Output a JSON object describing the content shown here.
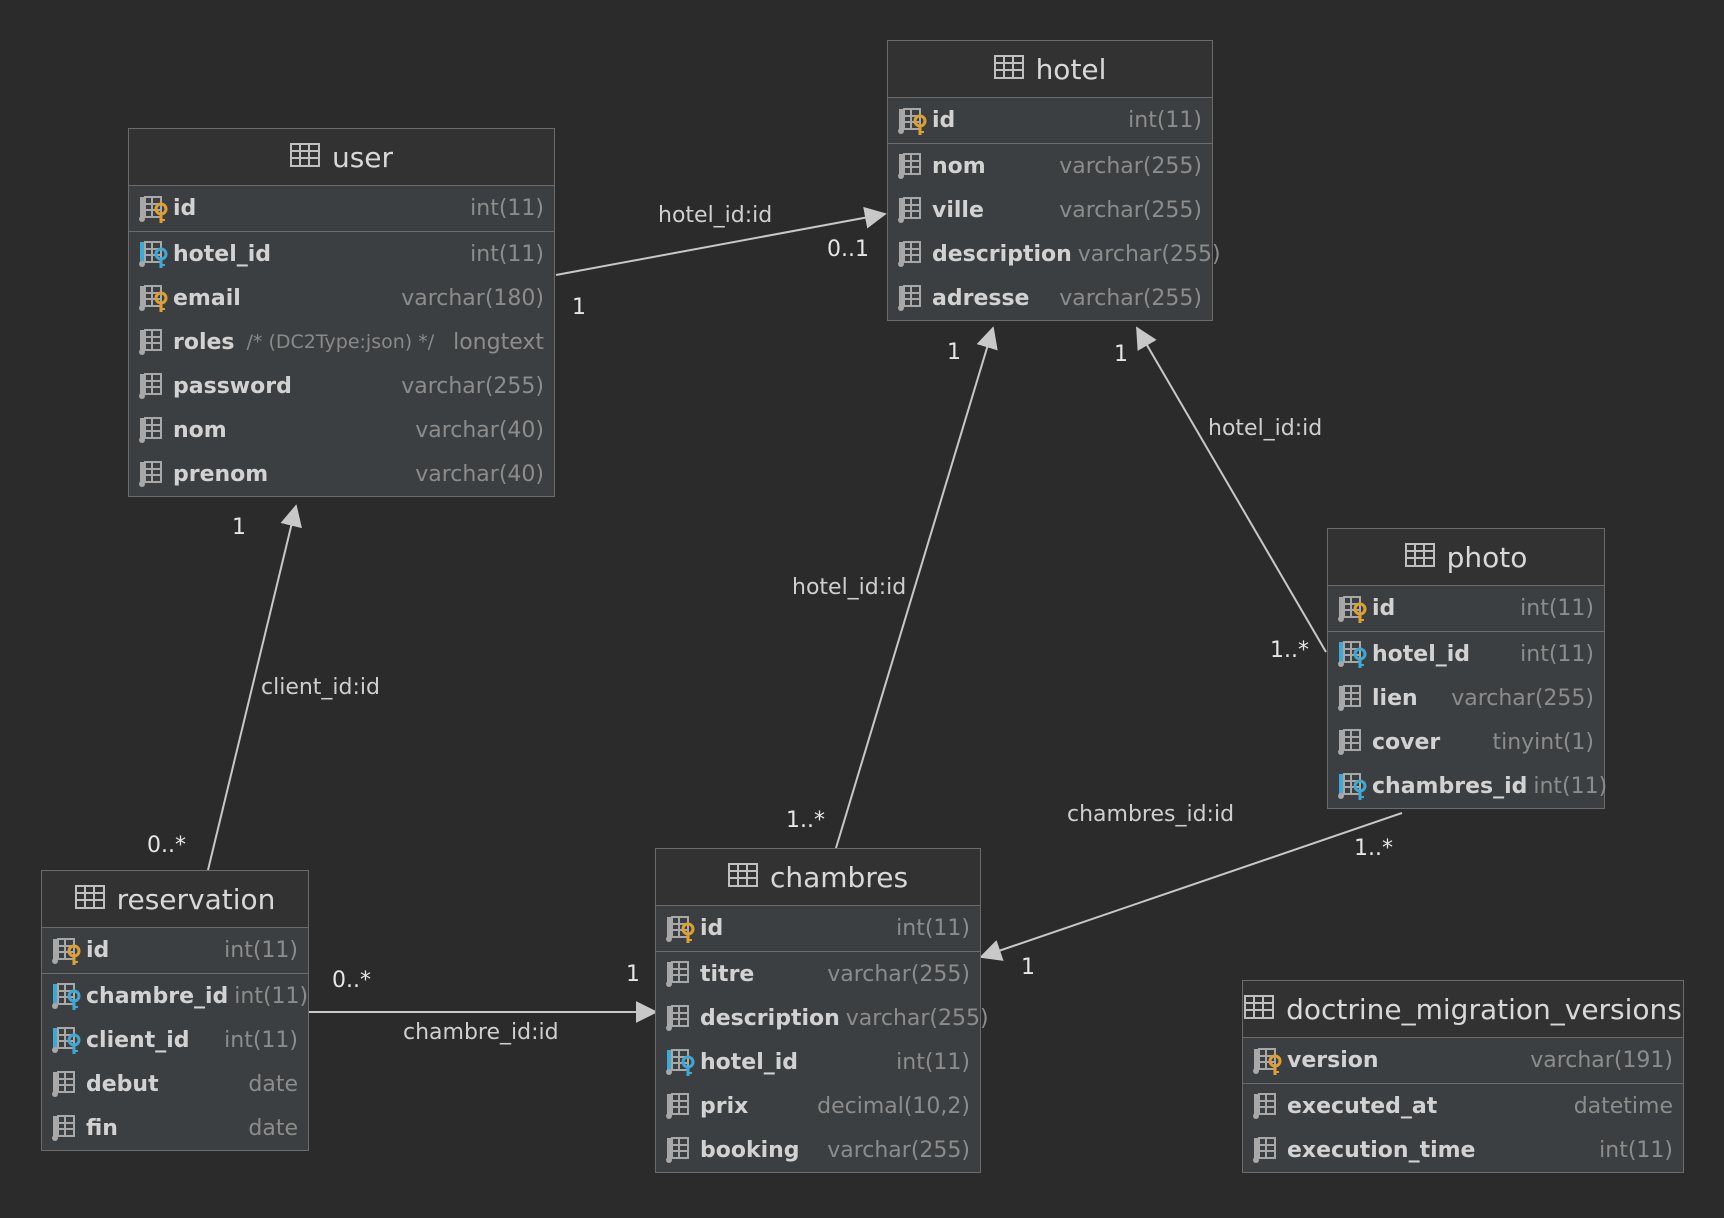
{
  "tables": {
    "user": {
      "name": "user",
      "columns": [
        {
          "name": "id",
          "type": "int(11)",
          "key": "pk"
        },
        {
          "name": "hotel_id",
          "type": "int(11)",
          "key": "fk"
        },
        {
          "name": "email",
          "type": "varchar(180)",
          "key": "uk"
        },
        {
          "name": "roles",
          "note": "/* (DC2Type:json) */",
          "type": "longtext",
          "key": "col"
        },
        {
          "name": "password",
          "type": "varchar(255)",
          "key": "col"
        },
        {
          "name": "nom",
          "type": "varchar(40)",
          "key": "col"
        },
        {
          "name": "prenom",
          "type": "varchar(40)",
          "key": "col"
        }
      ]
    },
    "hotel": {
      "name": "hotel",
      "columns": [
        {
          "name": "id",
          "type": "int(11)",
          "key": "pk"
        },
        {
          "name": "nom",
          "type": "varchar(255)",
          "key": "col"
        },
        {
          "name": "ville",
          "type": "varchar(255)",
          "key": "col"
        },
        {
          "name": "description",
          "type": "varchar(255)",
          "key": "col"
        },
        {
          "name": "adresse",
          "type": "varchar(255)",
          "key": "col"
        }
      ]
    },
    "photo": {
      "name": "photo",
      "columns": [
        {
          "name": "id",
          "type": "int(11)",
          "key": "pk"
        },
        {
          "name": "hotel_id",
          "type": "int(11)",
          "key": "fk"
        },
        {
          "name": "lien",
          "type": "varchar(255)",
          "key": "col"
        },
        {
          "name": "cover",
          "type": "tinyint(1)",
          "key": "col"
        },
        {
          "name": "chambres_id",
          "type": "int(11)",
          "key": "fk"
        }
      ]
    },
    "reservation": {
      "name": "reservation",
      "columns": [
        {
          "name": "id",
          "type": "int(11)",
          "key": "pk"
        },
        {
          "name": "chambre_id",
          "type": "int(11)",
          "key": "fk"
        },
        {
          "name": "client_id",
          "type": "int(11)",
          "key": "fk"
        },
        {
          "name": "debut",
          "type": "date",
          "key": "col"
        },
        {
          "name": "fin",
          "type": "date",
          "key": "col"
        }
      ]
    },
    "chambres": {
      "name": "chambres",
      "columns": [
        {
          "name": "id",
          "type": "int(11)",
          "key": "pk"
        },
        {
          "name": "titre",
          "type": "varchar(255)",
          "key": "col"
        },
        {
          "name": "description",
          "type": "varchar(255)",
          "key": "col"
        },
        {
          "name": "hotel_id",
          "type": "int(11)",
          "key": "fk"
        },
        {
          "name": "prix",
          "type": "decimal(10,2)",
          "key": "col"
        },
        {
          "name": "booking",
          "type": "varchar(255)",
          "key": "col"
        }
      ]
    },
    "doctrine_migration_versions": {
      "name": "doctrine_migration_versions",
      "columns": [
        {
          "name": "version",
          "type": "varchar(191)",
          "key": "pk"
        },
        {
          "name": "executed_at",
          "type": "datetime",
          "key": "col"
        },
        {
          "name": "execution_time",
          "type": "int(11)",
          "key": "col"
        }
      ]
    }
  },
  "relations": {
    "user_hotel": {
      "label": "hotel_id:id",
      "from_card": "1",
      "to_card": "0..1"
    },
    "chambres_hotel": {
      "label": "hotel_id:id",
      "from_card": "1..*",
      "to_card": "1"
    },
    "photo_hotel": {
      "label": "hotel_id:id",
      "from_card": "1..*",
      "to_card": "1"
    },
    "photo_chambres": {
      "label": "chambres_id:id",
      "from_card": "1..*",
      "to_card": "1"
    },
    "reservation_user": {
      "label": "client_id:id",
      "from_card": "0..*",
      "to_card": "1"
    },
    "reservation_chambres": {
      "label": "chambre_id:id",
      "from_card": "0..*",
      "to_card": "1"
    }
  },
  "colors": {
    "background": "#2b2b2b",
    "pk_key": "#e0a030",
    "fk_key": "#3fa9d6"
  }
}
